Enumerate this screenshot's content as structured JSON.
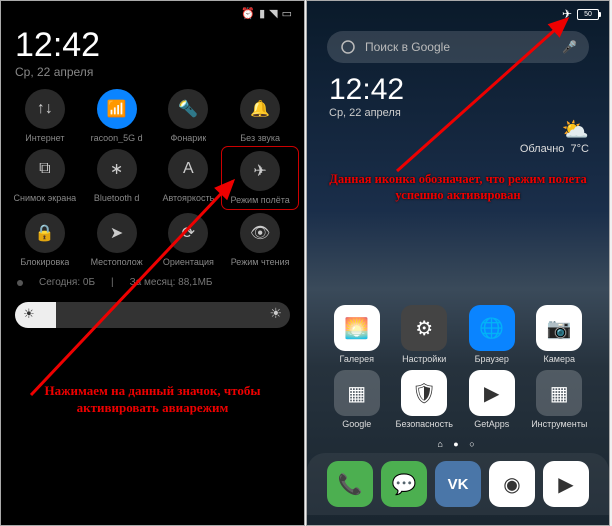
{
  "left": {
    "time": "12:42",
    "date": "Ср, 22 апреля",
    "tiles": [
      {
        "label": "Интернет",
        "name": "internet-icon"
      },
      {
        "label": "racoon_5G d",
        "name": "wifi-icon",
        "active": true
      },
      {
        "label": "Фонарик",
        "name": "flashlight-icon"
      },
      {
        "label": "Без звука",
        "name": "mute-icon"
      },
      {
        "label": "Снимок экрана",
        "name": "screenshot-icon"
      },
      {
        "label": "Bluetooth d",
        "name": "bluetooth-icon"
      },
      {
        "label": "Автояркость",
        "name": "autobright-icon"
      },
      {
        "label": "Режим полёта",
        "name": "airplane-mode-icon",
        "highlight": true
      },
      {
        "label": "Блокировка",
        "name": "lock-icon"
      },
      {
        "label": "Местополож",
        "name": "location-icon"
      },
      {
        "label": "Ориентация",
        "name": "orientation-icon"
      },
      {
        "label": "Режим чтения",
        "name": "reading-mode-icon"
      }
    ],
    "data_today_label": "Сегодня: 0Б",
    "data_month_label": "За месяц: 88,1МБ",
    "caption": "Нажимаем на данный значок, чтобы активировать авиарежим"
  },
  "right": {
    "battery": "50",
    "search_placeholder": "Поиск в Google",
    "time": "12:42",
    "date": "Ср, 22 апреля",
    "weather_cond": "Облачно",
    "weather_temp": "7°C",
    "apps_row1": [
      {
        "label": "Галерея",
        "name": "gallery-app",
        "bg": "#fff"
      },
      {
        "label": "Настройки",
        "name": "settings-app",
        "bg": "#444"
      },
      {
        "label": "Браузер",
        "name": "browser-app",
        "bg": "#0a84ff"
      },
      {
        "label": "Камера",
        "name": "camera-app",
        "bg": "#fff"
      }
    ],
    "apps_row2": [
      {
        "label": "Google",
        "name": "google-folder",
        "bg": "rgba(255,255,255,0.2)"
      },
      {
        "label": "Безопасность",
        "name": "security-app",
        "bg": "#fff"
      },
      {
        "label": "GetApps",
        "name": "getapps-app",
        "bg": "#fff"
      },
      {
        "label": "Инструменты",
        "name": "tools-folder",
        "bg": "rgba(255,255,255,0.2)"
      }
    ],
    "dock": [
      {
        "name": "phone-app",
        "bg": "#4caf50"
      },
      {
        "name": "messages-app",
        "bg": "#4caf50"
      },
      {
        "name": "vk-app",
        "bg": "#4a76a8"
      },
      {
        "name": "chrome-app",
        "bg": "#fff"
      },
      {
        "name": "play-app",
        "bg": "#fff"
      }
    ],
    "caption": "Данная иконка обозначает, что режим полета успешно активирован"
  }
}
